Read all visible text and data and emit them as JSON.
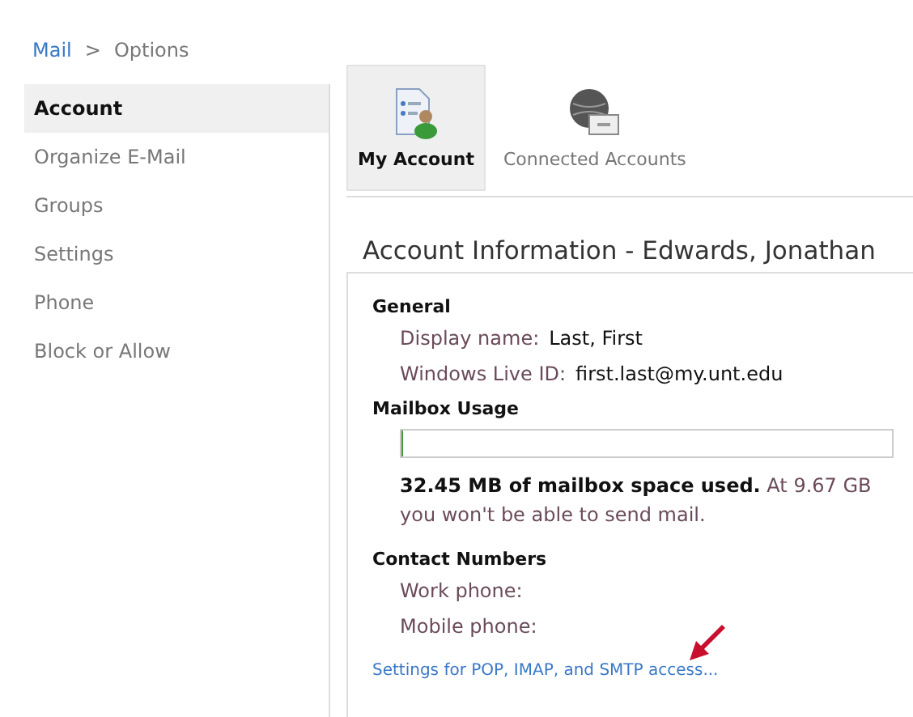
{
  "breadcrumb": [
    {
      "label": "Mail",
      "kind": "link"
    },
    {
      "label": ">",
      "kind": "separator"
    },
    {
      "label": "Options",
      "kind": "current"
    }
  ],
  "sidebar": {
    "items": [
      {
        "label": "Account",
        "selected": true
      },
      {
        "label": "Organize E-Mail",
        "selected": false
      },
      {
        "label": "Groups",
        "selected": false
      },
      {
        "label": "Settings",
        "selected": false
      },
      {
        "label": "Phone",
        "selected": false
      },
      {
        "label": "Block or Allow",
        "selected": false
      }
    ]
  },
  "toolbar": [
    {
      "label": "My Account",
      "kind": "account",
      "selected": true
    },
    {
      "label": "Connected Accounts",
      "kind": "globe",
      "selected": false
    }
  ],
  "heading": "Account Information - Edwards, Jonathan",
  "general": {
    "title": "General",
    "fields": [
      {
        "label": "Display name:",
        "value": "Last, First"
      },
      {
        "label": "Windows Live ID:",
        "value": "first.last@my.unt.edu"
      }
    ]
  },
  "mailbox_usage": {
    "title": "Mailbox Usage",
    "level": 0.003,
    "text": "**32.45 MB of mailbox space used.** At 9.67 GB you won't be able to send mail."
  },
  "contact_numbers": {
    "title": "Contact Numbers",
    "fields": [
      {
        "label": "Work phone:"
      },
      {
        "label": "Mobile phone:"
      }
    ]
  },
  "link": "Settings for POP, IMAP, and SMTP access..."
}
